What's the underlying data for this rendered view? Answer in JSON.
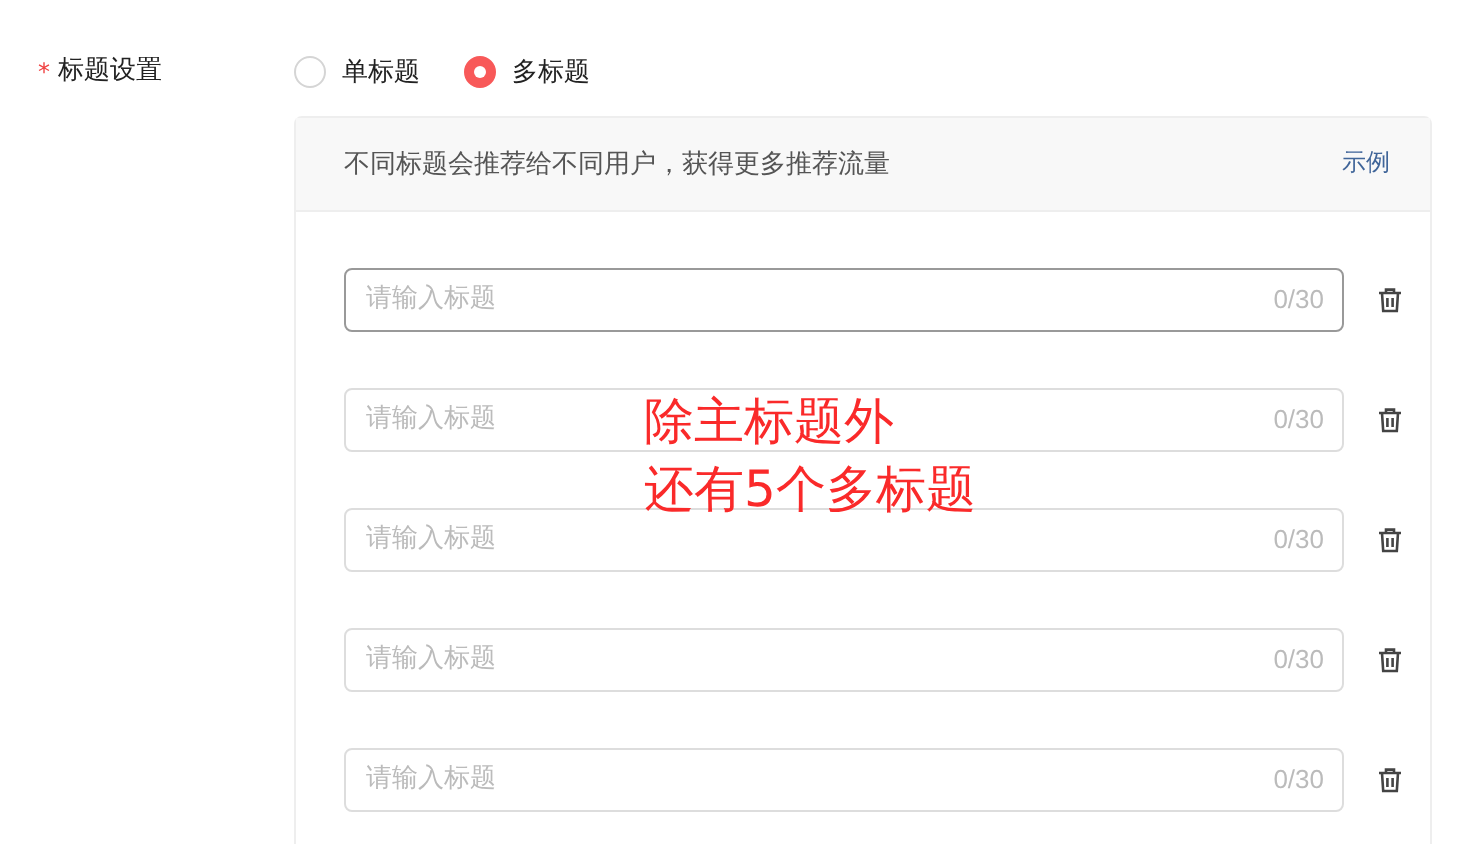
{
  "field_label": {
    "required_mark": "*",
    "text": "标题设置"
  },
  "radio_options": [
    {
      "label": "单标题",
      "selected": false
    },
    {
      "label": "多标题",
      "selected": true
    }
  ],
  "panel": {
    "tip": "不同标题会推荐给不同用户，获得更多推荐流量",
    "example_link": "示例"
  },
  "title_inputs": [
    {
      "placeholder": "请输入标题",
      "counter": "0/30",
      "focused": true
    },
    {
      "placeholder": "请输入标题",
      "counter": "0/30",
      "focused": false
    },
    {
      "placeholder": "请输入标题",
      "counter": "0/30",
      "focused": false
    },
    {
      "placeholder": "请输入标题",
      "counter": "0/30",
      "focused": false
    },
    {
      "placeholder": "请输入标题",
      "counter": "0/30",
      "focused": false
    }
  ],
  "annotation": [
    "除主标题外",
    "还有5个多标题"
  ]
}
